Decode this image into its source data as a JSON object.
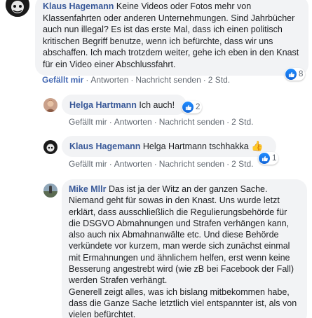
{
  "comments": [
    {
      "author": "Klaus Hagemann",
      "text": "Keine Videos oder Fotos mehr von Klassenfahrten oder anderen Unternehmungen. Sind Jahrbücher auch nun illegal? Es ist das erste Mal, dass ich einen politisch kritischen Begriff benutze, wenn ich befürchte, dass wir uns abschaffen. Ich mach trotzdem weiter, gehe ich eben in den Knast für ein Video einer Abschlussfahrt.",
      "reaction_count": "8",
      "actions": {
        "like": "Gefällt mir",
        "reply": "Antworten",
        "message": "Nachricht senden",
        "time": "2 Std."
      }
    },
    {
      "author": "Helga Hartmann",
      "text": "Ich auch!",
      "reaction_count": "2",
      "actions": {
        "like": "Gefällt mir",
        "reply": "Antworten",
        "message": "Nachricht senden",
        "time": "2 Std."
      }
    },
    {
      "author": "Klaus Hagemann",
      "text": "Helga Hartmann tschhakka",
      "emoji": "👍",
      "reaction_count": "1",
      "actions": {
        "like": "Gefällt mir",
        "reply": "Antworten",
        "message": "Nachricht senden",
        "time": "2 Std."
      }
    },
    {
      "author": "Mike Mllr",
      "text": "Das ist ja der Witz an der ganzen Sache. Niemand geht für sowas in den Knast. Uns wurde letzt erklärt, dass ausschließlich die Regulierungsbehörde für die DSGVO Abmahnungen und Strafen verhängen kann, also auch nix Abmahnanwälte etc. Und diese Behörde verkündete vor kurzem, man werde sich zunächst einmal mit Ermahnungen und ähnlichem helfen, erst wenn keine Besserung angestrebt wird (wie zB bei Facebook der Fall) werden Strafen verhängt.",
      "text2": "Generell zeigt alles, was ich bislang mitbekommen habe, dass die Ganze Sache letztlich viel entspannter ist, als von vielen befürchtet."
    }
  ],
  "colors": {
    "link": "#385898",
    "bubble": "#f2f3f5",
    "meta": "#606770",
    "like_blue": "#4267b2"
  }
}
